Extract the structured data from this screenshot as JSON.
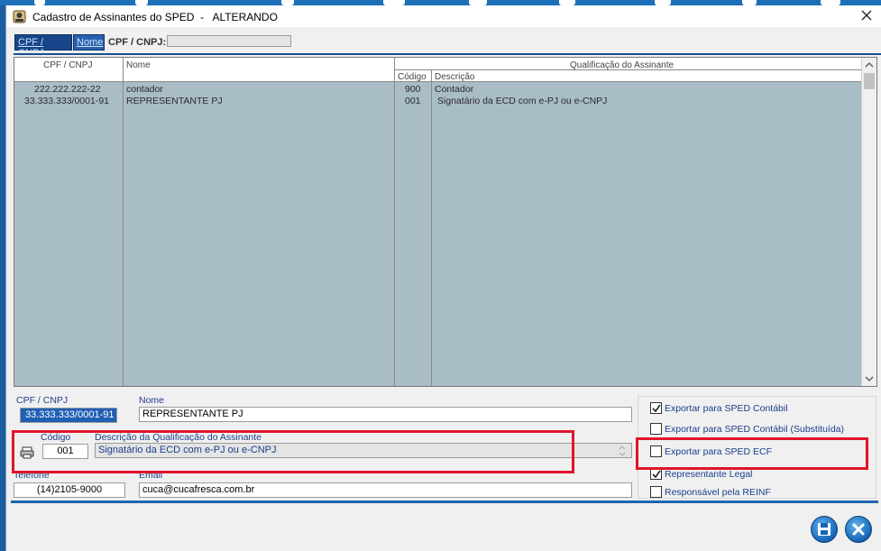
{
  "window": {
    "title": "Cadastro de Assinantes do SPED  -   ALTERANDO"
  },
  "search": {
    "tab_cpf": "CPF / CNPJ",
    "tab_nome": "Nome",
    "label": "CPF / CNPJ:",
    "value": ""
  },
  "grid": {
    "columns": {
      "cpf": "CPF / CNPJ",
      "nome": "Nome",
      "group": "Qualificação do Assinante",
      "codigo": "Código",
      "descricao": "Descrição"
    },
    "rows": [
      {
        "cpf": "222.222.222-22",
        "nome": "contador",
        "codigo": "900",
        "descricao": "Contador"
      },
      {
        "cpf": "33.333.333/0001-91",
        "nome": "REPRESENTANTE PJ",
        "codigo": "001",
        "descricao": " Signatário da ECD com e-PJ ou e-CNPJ"
      }
    ]
  },
  "form": {
    "cpf_label": "CPF / CNPJ",
    "cpf_value": "33.333.333/0001-91",
    "nome_label": "Nome",
    "nome_value": "REPRESENTANTE PJ",
    "codigo_label": "Código",
    "codigo_value": "001",
    "descricao_label": "Descrição da Qualificação do Assinante",
    "descricao_value": "Signatário da ECD com e-PJ ou e-CNPJ",
    "telefone_label": "Telefone",
    "telefone_value": "(14)2105-9000",
    "email_label": "Email",
    "email_value": "cuca@cucafresca.com.br"
  },
  "checks": [
    {
      "label": "Exportar para SPED Contábil",
      "checked": true
    },
    {
      "label": "Exportar para SPED Contábil (Substituída)",
      "checked": false
    },
    {
      "label": "Exportar para SPED ECF",
      "checked": false
    },
    {
      "label": "Representante Legal",
      "checked": true
    },
    {
      "label": "Responsável pela REINF",
      "checked": false
    }
  ],
  "colors": {
    "accent": "#1f5fb5",
    "highlight": "#e0142b",
    "grid_bg": "#a9bdc7"
  },
  "icons": [
    "app-icon",
    "close-icon",
    "printer-icon",
    "save-icon",
    "cancel-icon"
  ]
}
